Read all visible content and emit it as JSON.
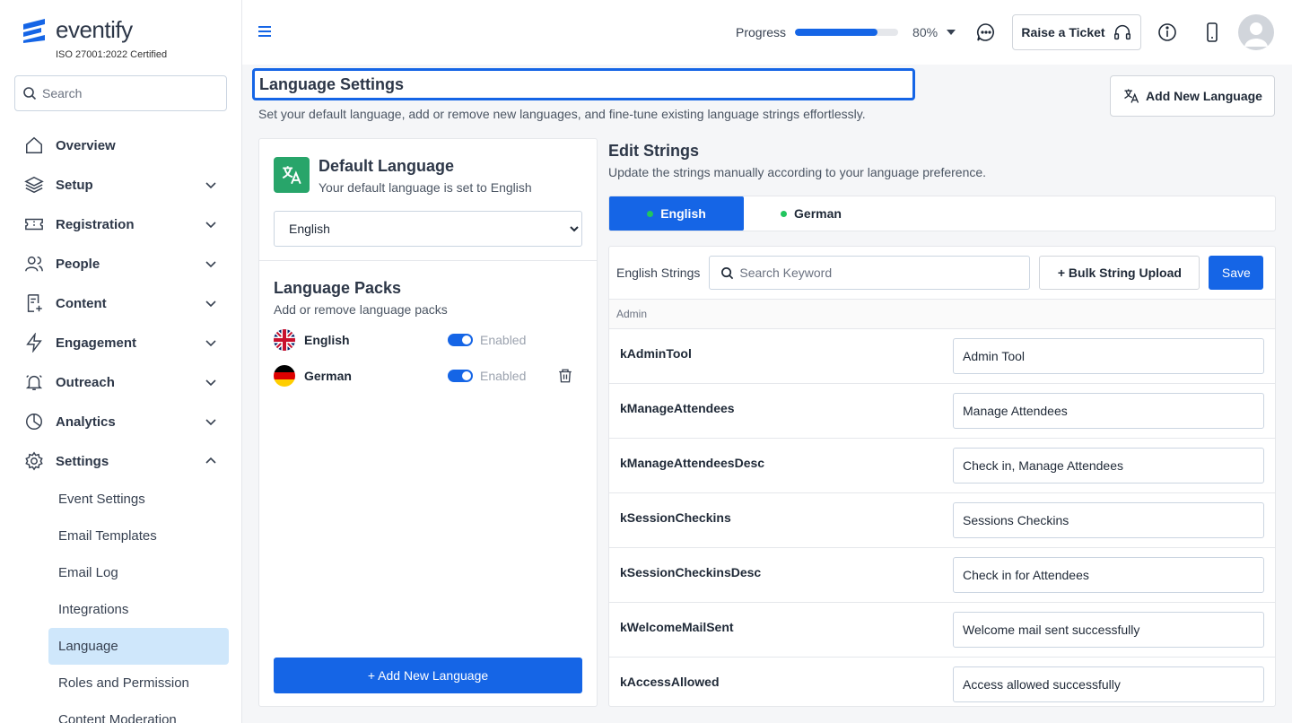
{
  "brand": {
    "name": "eventify",
    "certification": "ISO 27001:2022 Certified"
  },
  "sidebar": {
    "search_placeholder": "Search",
    "items": [
      {
        "label": "Overview",
        "icon": "home-icon",
        "expandable": false
      },
      {
        "label": "Setup",
        "icon": "layers-icon",
        "expandable": true
      },
      {
        "label": "Registration",
        "icon": "ticket-icon",
        "expandable": true
      },
      {
        "label": "People",
        "icon": "people-icon",
        "expandable": true
      },
      {
        "label": "Content",
        "icon": "document-icon",
        "expandable": true
      },
      {
        "label": "Engagement",
        "icon": "lightning-icon",
        "expandable": true
      },
      {
        "label": "Outreach",
        "icon": "bell-icon",
        "expandable": true
      },
      {
        "label": "Analytics",
        "icon": "pie-chart-icon",
        "expandable": true
      },
      {
        "label": "Settings",
        "icon": "gear-icon",
        "expandable": true,
        "expanded": true
      }
    ],
    "settings_sub": [
      {
        "label": "Event Settings"
      },
      {
        "label": "Email Templates"
      },
      {
        "label": "Email Log"
      },
      {
        "label": "Integrations"
      },
      {
        "label": "Language",
        "active": true
      },
      {
        "label": "Roles and Permission"
      },
      {
        "label": "Content Moderation"
      }
    ]
  },
  "topbar": {
    "progress_label": "Progress",
    "progress_value": 0.8,
    "progress_text": "80%",
    "ticket_label": "Raise a Ticket"
  },
  "page": {
    "title": "Language Settings",
    "description": "Set your default language, add or remove new languages, and fine-tune existing language strings effortlessly.",
    "add_language_label": "Add New Language"
  },
  "default_language": {
    "title": "Default Language",
    "subtitle": "Your default language is set to English",
    "selected": "English"
  },
  "language_packs": {
    "title": "Language Packs",
    "subtitle": "Add or remove language packs",
    "packs": [
      {
        "name": "English",
        "status": "Enabled",
        "flag": "uk-flag-icon",
        "deletable": false
      },
      {
        "name": "German",
        "status": "Enabled",
        "flag": "germany-flag-icon",
        "deletable": true
      }
    ],
    "add_button": "+ Add New Language"
  },
  "edit_strings": {
    "title": "Edit Strings",
    "subtitle": "Update the strings manually according to your language preference.",
    "tabs": [
      {
        "label": "English",
        "active": true
      },
      {
        "label": "German",
        "active": false
      }
    ],
    "toolbar_label": "English Strings",
    "search_placeholder": "Search Keyword",
    "bulk_label": "+ Bulk String Upload",
    "save_label": "Save",
    "group": "Admin",
    "rows": [
      {
        "key": "kAdminTool",
        "value": "Admin Tool"
      },
      {
        "key": "kManageAttendees",
        "value": "Manage Attendees"
      },
      {
        "key": "kManageAttendeesDesc",
        "value": "Check in, Manage Attendees"
      },
      {
        "key": "kSessionCheckins",
        "value": "Sessions Checkins"
      },
      {
        "key": "kSessionCheckinsDesc",
        "value": "Check in for Attendees"
      },
      {
        "key": "kWelcomeMailSent",
        "value": "Welcome mail sent successfully"
      },
      {
        "key": "kAccessAllowed",
        "value": "Access allowed successfully"
      }
    ]
  },
  "colors": {
    "accent": "#1565e6",
    "success": "#28a56a",
    "active_bg": "#cfe7fb"
  }
}
